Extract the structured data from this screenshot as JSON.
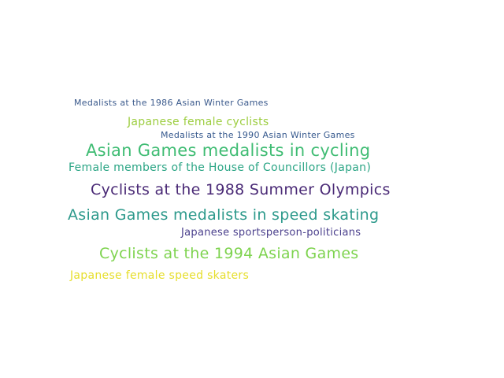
{
  "words": [
    {
      "text": "Medalists at the 1986 Asian Winter Games",
      "color": "#3b5a8c"
    },
    {
      "text": "Japanese female cyclists",
      "color": "#9ccd3f"
    },
    {
      "text": "Medalists at the 1990 Asian Winter Games",
      "color": "#35588d"
    },
    {
      "text": "Asian Games medalists in cycling",
      "color": "#3fbc73"
    },
    {
      "text": "Female members of the House of Councillors (Japan)",
      "color": "#2ba585"
    },
    {
      "text": "Cyclists at the 1988 Summer Olympics",
      "color": "#4a2a76"
    },
    {
      "text": "Asian Games medalists in speed skating",
      "color": "#2e9a8c"
    },
    {
      "text": "Japanese sportsperson-politicians",
      "color": "#4a3f8c"
    },
    {
      "text": "Cyclists at the 1994 Asian Games",
      "color": "#7ed34f"
    },
    {
      "text": "Japanese female speed skaters",
      "color": "#e6de2b"
    }
  ]
}
